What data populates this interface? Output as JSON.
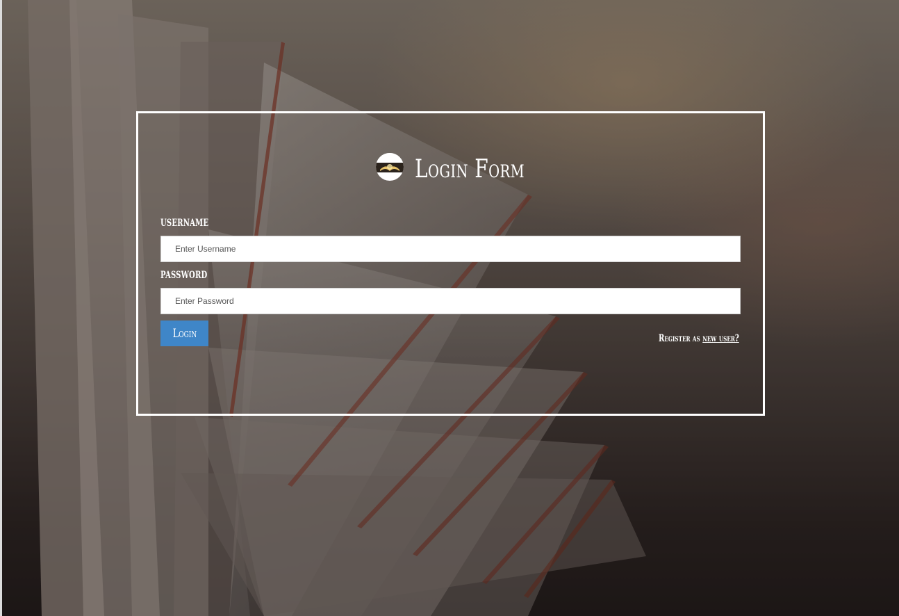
{
  "form": {
    "title": "Login Form",
    "logo_icon": "open-book-logo-icon",
    "username_label": "Username",
    "username_placeholder": "Enter Username",
    "password_label": "Password",
    "password_placeholder": "Enter Password",
    "login_label": "Login",
    "register_prefix": "Register as",
    "register_link": "new user?"
  },
  "colors": {
    "accent": "#3f86c8",
    "border": "#ffffff",
    "text": "#ffffff"
  }
}
